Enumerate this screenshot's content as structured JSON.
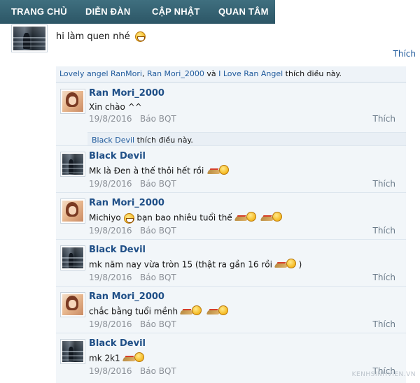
{
  "nav": {
    "items": [
      "TRANG CHỦ",
      "DIỄN ĐÀN",
      "CẬP NHẬT",
      "QUAN TÂM"
    ]
  },
  "status": {
    "text": "hi làm quen nhé",
    "emoticon": "grin-emoticon",
    "like_label": "Thích"
  },
  "likes": {
    "names": [
      "Lovely angel RanMori",
      "Ran Mori_2000",
      "I Love Ran Angel"
    ],
    "sep1": ", ",
    "sep2": " và ",
    "suffix": " thích điều này."
  },
  "comments": [
    {
      "author": "Ran Mori_2000",
      "avatar": "girl-avatar",
      "text": "Xin chào ^^",
      "date": "19/8/2016",
      "report": "Báo BQT",
      "like": "Thích",
      "liked_by": "Black Devil",
      "liked_suffix": " thích điều này."
    },
    {
      "author": "Black Devil",
      "avatar": "dark-avatar",
      "text": "Mk là Đen à thế thôi hết rồi",
      "date": "19/8/2016",
      "report": "Báo BQT",
      "like": "Thích"
    },
    {
      "author": "Ran Mori_2000",
      "avatar": "girl-avatar",
      "text_before": "Michiyo",
      "text_after": "bạn bao nhiêu tuổi thế",
      "date": "19/8/2016",
      "report": "Báo BQT",
      "like": "Thích"
    },
    {
      "author": "Black Devil",
      "avatar": "dark-avatar",
      "text_before": "mk năm nay vừa tròn 15 (thật ra gần 16 rồi",
      "text_after": ")",
      "date": "19/8/2016",
      "report": "Báo BQT",
      "like": "Thích"
    },
    {
      "author": "Ran Mori_2000",
      "avatar": "girl-avatar",
      "text": "chắc bằng tuổi mềnh",
      "date": "19/8/2016",
      "report": "Báo BQT",
      "like": "Thích"
    },
    {
      "author": "Black Devil",
      "avatar": "dark-avatar",
      "text": "mk 2k1",
      "date": "19/8/2016",
      "report": "Báo BQT",
      "like": "Thích"
    }
  ],
  "watermark": "KENHSINHVIEN.VN"
}
